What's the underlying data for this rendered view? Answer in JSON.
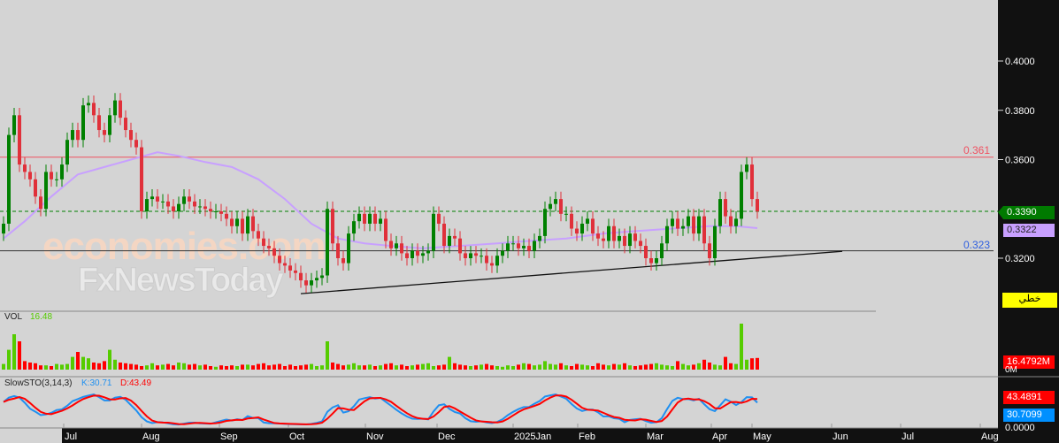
{
  "chart_data": {
    "type": "candlestick",
    "price_axis": {
      "ticks": [
        "0.4000",
        "0.3800",
        "0.3600",
        "0.3200"
      ],
      "tick_values": [
        0.4,
        0.38,
        0.36,
        0.32
      ],
      "range": [
        0.3,
        0.412
      ]
    },
    "x_ticks": [
      "Jul",
      "Aug",
      "Sep",
      "Oct",
      "Nov",
      "Dec",
      "2025Jan",
      "Feb",
      "Mar",
      "Apr",
      "May",
      "Jun",
      "Jul",
      "Aug"
    ],
    "close": [
      0.334,
      0.37,
      0.378,
      0.358,
      0.355,
      0.352,
      0.345,
      0.34,
      0.355,
      0.352,
      0.352,
      0.358,
      0.368,
      0.372,
      0.368,
      0.382,
      0.383,
      0.378,
      0.372,
      0.37,
      0.378,
      0.384,
      0.377,
      0.372,
      0.368,
      0.365,
      0.339,
      0.344,
      0.345,
      0.343,
      0.343,
      0.341,
      0.339,
      0.342,
      0.345,
      0.343,
      0.341,
      0.341,
      0.34,
      0.339,
      0.339,
      0.338,
      0.336,
      0.333,
      0.336,
      0.33,
      0.337,
      0.331,
      0.328,
      0.325,
      0.324,
      0.321,
      0.318,
      0.317,
      0.315,
      0.314,
      0.311,
      0.309,
      0.311,
      0.312,
      0.313,
      0.34,
      0.326,
      0.32,
      0.318,
      0.33,
      0.335,
      0.338,
      0.334,
      0.338,
      0.334,
      0.336,
      0.327,
      0.324,
      0.326,
      0.322,
      0.32,
      0.323,
      0.321,
      0.322,
      0.323,
      0.338,
      0.334,
      0.325,
      0.329,
      0.328,
      0.322,
      0.32,
      0.322,
      0.321,
      0.321,
      0.318,
      0.317,
      0.321,
      0.323,
      0.326,
      0.326,
      0.324,
      0.325,
      0.323,
      0.327,
      0.329,
      0.34,
      0.342,
      0.344,
      0.338,
      0.338,
      0.332,
      0.33,
      0.334,
      0.336,
      0.33,
      0.328,
      0.327,
      0.333,
      0.327,
      0.329,
      0.325,
      0.33,
      0.327,
      0.325,
      0.32,
      0.318,
      0.32,
      0.326,
      0.333,
      0.336,
      0.332,
      0.333,
      0.337,
      0.33,
      0.337,
      0.326,
      0.32,
      0.333,
      0.344,
      0.337,
      0.333,
      0.336,
      0.355,
      0.358,
      0.344,
      0.339
    ],
    "volume_millions": [
      8,
      28,
      50,
      40,
      12,
      10,
      9,
      6,
      6,
      5,
      8,
      7,
      8,
      18,
      25,
      18,
      16,
      10,
      9,
      12,
      28,
      14,
      10,
      9,
      8,
      7,
      5,
      6,
      9,
      6,
      7,
      8,
      6,
      10,
      9,
      7,
      8,
      6,
      7,
      5,
      4,
      6,
      5,
      6,
      5,
      7,
      7,
      6,
      8,
      9,
      6,
      7,
      8,
      5,
      7,
      5,
      6,
      7,
      8,
      5,
      6,
      40,
      10,
      8,
      6,
      7,
      9,
      6,
      6,
      7,
      5,
      6,
      8,
      9,
      6,
      7,
      5,
      6,
      7,
      8,
      9,
      5,
      6,
      7,
      18,
      9,
      7,
      6,
      5,
      6,
      7,
      8,
      6,
      5,
      4,
      6,
      5,
      7,
      9,
      8,
      6,
      7,
      12,
      8,
      7,
      9,
      6,
      5,
      8,
      7,
      6,
      5,
      9,
      7,
      6,
      8,
      7,
      9,
      6,
      5,
      6,
      7,
      8,
      9,
      7,
      6,
      5,
      12,
      8,
      6,
      7,
      9,
      14,
      10,
      7,
      6,
      18,
      9,
      8,
      65,
      14,
      16,
      16.48
    ],
    "moving_average": [
      [
        0,
        0.328
      ],
      [
        4,
        0.335
      ],
      [
        9,
        0.345
      ],
      [
        14,
        0.354
      ],
      [
        19,
        0.357
      ],
      [
        24,
        0.36
      ],
      [
        29,
        0.363
      ],
      [
        33,
        0.3615
      ],
      [
        38,
        0.359
      ],
      [
        43,
        0.357
      ],
      [
        48,
        0.352
      ],
      [
        53,
        0.344
      ],
      [
        58,
        0.334
      ],
      [
        63,
        0.328
      ],
      [
        68,
        0.326
      ],
      [
        73,
        0.325
      ],
      [
        79,
        0.324
      ],
      [
        86,
        0.325
      ],
      [
        93,
        0.326
      ],
      [
        99,
        0.327
      ],
      [
        106,
        0.328
      ],
      [
        113,
        0.33
      ],
      [
        119,
        0.331
      ],
      [
        126,
        0.332
      ],
      [
        133,
        0.333
      ],
      [
        138,
        0.333
      ],
      [
        142,
        0.3322
      ]
    ],
    "levels": {
      "resistance": 0.361,
      "current": 0.339,
      "support": 0.323
    },
    "trendline": [
      [
        56,
        0.3056
      ],
      [
        158,
        0.3228
      ]
    ],
    "stochastic": {
      "label": "SlowSTO(3,14,3)",
      "k_label": "K:30.71",
      "d_label": "D:43.49",
      "k": 30.7099,
      "d": 43.4891,
      "range": [
        0,
        100
      ]
    },
    "colors": {
      "up": "#008000",
      "down": "#e0303a",
      "ma": "#c8a0ff",
      "resistance": "#f05060",
      "support": "#3060e0",
      "current": "#008000",
      "k": "#2090f0",
      "d": "#ff0000"
    }
  },
  "labels": {
    "resistance": "0.361",
    "support": "0.323",
    "current_tag": "0.3390",
    "ma_tag": "0.3322",
    "chart_type_tag": "خطي",
    "vol_title": "VOL",
    "vol_value": "16.48",
    "vol_tag": "16.4792M",
    "vol_zero": "0M",
    "sto_title": "SlowSTO(3,14,3)",
    "sto_k": "K:30.71",
    "sto_d": "D:43.49",
    "d_tag": "43.4891",
    "k_tag": "30.7099",
    "sto_zero": "0.0000"
  },
  "watermark": {
    "line1": "economies.com",
    "line2": "FxNewsToday"
  }
}
